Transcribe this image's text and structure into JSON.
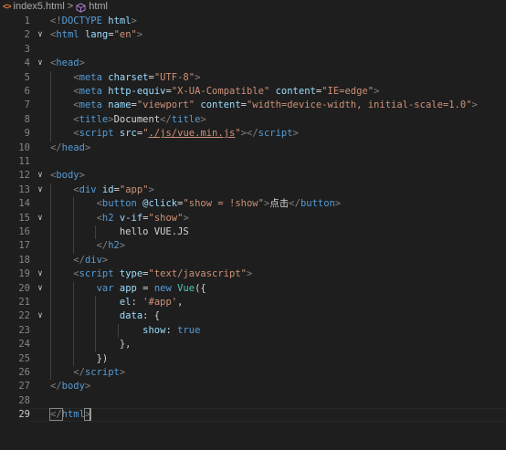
{
  "breadcrumb": {
    "file_icon": "<>",
    "file": "index5.html",
    "separator": ">",
    "node_icon": "cube-icon",
    "node": "html"
  },
  "editor": {
    "active_line": 29,
    "lines": [
      {
        "n": "1",
        "fold": "",
        "tokens": [
          [
            "br",
            "<!"
          ],
          [
            "tag",
            "DOCTYPE"
          ],
          [
            "at",
            " html"
          ],
          [
            "br",
            ">"
          ]
        ]
      },
      {
        "n": "2",
        "fold": "∨",
        "tokens": [
          [
            "br",
            "<"
          ],
          [
            "tag",
            "html"
          ],
          [
            "at",
            " lang"
          ],
          [
            "pl",
            "="
          ],
          [
            "str",
            "\"en\""
          ],
          [
            "br",
            ">"
          ]
        ]
      },
      {
        "n": "3",
        "fold": "",
        "tokens": []
      },
      {
        "n": "4",
        "fold": "∨",
        "tokens": [
          [
            "br",
            "<"
          ],
          [
            "tag",
            "head"
          ],
          [
            "br",
            ">"
          ]
        ]
      },
      {
        "n": "5",
        "fold": "",
        "tokens": [
          [
            "pl",
            "    "
          ],
          [
            "br",
            "<"
          ],
          [
            "tag",
            "meta"
          ],
          [
            "at",
            " charset"
          ],
          [
            "pl",
            "="
          ],
          [
            "str",
            "\"UTF-8\""
          ],
          [
            "br",
            ">"
          ]
        ]
      },
      {
        "n": "6",
        "fold": "",
        "tokens": [
          [
            "pl",
            "    "
          ],
          [
            "br",
            "<"
          ],
          [
            "tag",
            "meta"
          ],
          [
            "at",
            " http-equiv"
          ],
          [
            "pl",
            "="
          ],
          [
            "str",
            "\"X-UA-Compatible\""
          ],
          [
            "at",
            " content"
          ],
          [
            "pl",
            "="
          ],
          [
            "str",
            "\"IE=edge\""
          ],
          [
            "br",
            ">"
          ]
        ]
      },
      {
        "n": "7",
        "fold": "",
        "tokens": [
          [
            "pl",
            "    "
          ],
          [
            "br",
            "<"
          ],
          [
            "tag",
            "meta"
          ],
          [
            "at",
            " name"
          ],
          [
            "pl",
            "="
          ],
          [
            "str",
            "\"viewport\""
          ],
          [
            "at",
            " content"
          ],
          [
            "pl",
            "="
          ],
          [
            "str",
            "\"width=device-width, initial-scale=1.0\""
          ],
          [
            "br",
            ">"
          ]
        ]
      },
      {
        "n": "8",
        "fold": "",
        "tokens": [
          [
            "pl",
            "    "
          ],
          [
            "br",
            "<"
          ],
          [
            "tag",
            "title"
          ],
          [
            "br",
            ">"
          ],
          [
            "txt",
            "Document"
          ],
          [
            "br",
            "</"
          ],
          [
            "tag",
            "title"
          ],
          [
            "br",
            ">"
          ]
        ]
      },
      {
        "n": "9",
        "fold": "",
        "tokens": [
          [
            "pl",
            "    "
          ],
          [
            "br",
            "<"
          ],
          [
            "tag",
            "script"
          ],
          [
            "at",
            " src"
          ],
          [
            "pl",
            "="
          ],
          [
            "str",
            "\""
          ],
          [
            "link",
            "./js/vue.min.js"
          ],
          [
            "str",
            "\""
          ],
          [
            "br",
            "></"
          ],
          [
            "tag",
            "script"
          ],
          [
            "br",
            ">"
          ]
        ]
      },
      {
        "n": "10",
        "fold": "",
        "tokens": [
          [
            "br",
            "</"
          ],
          [
            "tag",
            "head"
          ],
          [
            "br",
            ">"
          ]
        ]
      },
      {
        "n": "11",
        "fold": "",
        "tokens": []
      },
      {
        "n": "12",
        "fold": "∨",
        "tokens": [
          [
            "br",
            "<"
          ],
          [
            "tag",
            "body"
          ],
          [
            "br",
            ">"
          ]
        ]
      },
      {
        "n": "13",
        "fold": "∨",
        "tokens": [
          [
            "pl",
            "    "
          ],
          [
            "br",
            "<"
          ],
          [
            "tag",
            "div"
          ],
          [
            "at",
            " id"
          ],
          [
            "pl",
            "="
          ],
          [
            "str",
            "\"app\""
          ],
          [
            "br",
            ">"
          ]
        ]
      },
      {
        "n": "14",
        "fold": "",
        "tokens": [
          [
            "pl",
            "        "
          ],
          [
            "br",
            "<"
          ],
          [
            "tag",
            "button"
          ],
          [
            "at",
            " @click"
          ],
          [
            "pl",
            "="
          ],
          [
            "str",
            "\"show = !show\""
          ],
          [
            "br",
            ">"
          ],
          [
            "txt",
            "点击"
          ],
          [
            "br",
            "</"
          ],
          [
            "tag",
            "button"
          ],
          [
            "br",
            ">"
          ]
        ]
      },
      {
        "n": "15",
        "fold": "∨",
        "tokens": [
          [
            "pl",
            "        "
          ],
          [
            "br",
            "<"
          ],
          [
            "tag",
            "h2"
          ],
          [
            "at",
            " v-if"
          ],
          [
            "pl",
            "="
          ],
          [
            "str",
            "\"show\""
          ],
          [
            "br",
            ">"
          ]
        ]
      },
      {
        "n": "16",
        "fold": "",
        "tokens": [
          [
            "pl",
            "            "
          ],
          [
            "txt",
            "hello VUE.JS"
          ]
        ]
      },
      {
        "n": "17",
        "fold": "",
        "tokens": [
          [
            "pl",
            "        "
          ],
          [
            "br",
            "</"
          ],
          [
            "tag",
            "h2"
          ],
          [
            "br",
            ">"
          ]
        ]
      },
      {
        "n": "18",
        "fold": "",
        "tokens": [
          [
            "pl",
            "    "
          ],
          [
            "br",
            "</"
          ],
          [
            "tag",
            "div"
          ],
          [
            "br",
            ">"
          ]
        ]
      },
      {
        "n": "19",
        "fold": "∨",
        "tokens": [
          [
            "pl",
            "    "
          ],
          [
            "br",
            "<"
          ],
          [
            "tag",
            "script"
          ],
          [
            "at",
            " type"
          ],
          [
            "pl",
            "="
          ],
          [
            "str",
            "\"text/javascript\""
          ],
          [
            "br",
            ">"
          ]
        ]
      },
      {
        "n": "20",
        "fold": "∨",
        "tokens": [
          [
            "pl",
            "        "
          ],
          [
            "kw",
            "var"
          ],
          [
            "var",
            " app"
          ],
          [
            "pl",
            " = "
          ],
          [
            "kw",
            "new"
          ],
          [
            "fn",
            " Vue"
          ],
          [
            "pl",
            "({"
          ]
        ]
      },
      {
        "n": "21",
        "fold": "",
        "tokens": [
          [
            "pl",
            "            "
          ],
          [
            "var",
            "el"
          ],
          [
            "pl",
            ": "
          ],
          [
            "str",
            "'#app'"
          ],
          [
            "pl",
            ","
          ]
        ]
      },
      {
        "n": "22",
        "fold": "∨",
        "tokens": [
          [
            "pl",
            "            "
          ],
          [
            "var",
            "data"
          ],
          [
            "pl",
            ": {"
          ]
        ]
      },
      {
        "n": "23",
        "fold": "",
        "tokens": [
          [
            "pl",
            "                "
          ],
          [
            "var",
            "show"
          ],
          [
            "pl",
            ": "
          ],
          [
            "kw",
            "true"
          ]
        ]
      },
      {
        "n": "24",
        "fold": "",
        "tokens": [
          [
            "pl",
            "            "
          ],
          [
            "pl",
            "},"
          ]
        ]
      },
      {
        "n": "25",
        "fold": "",
        "tokens": [
          [
            "pl",
            "        "
          ],
          [
            "pl",
            "})"
          ]
        ]
      },
      {
        "n": "26",
        "fold": "",
        "tokens": [
          [
            "pl",
            "    "
          ],
          [
            "br",
            "</"
          ],
          [
            "tag",
            "script"
          ],
          [
            "br",
            ">"
          ]
        ]
      },
      {
        "n": "27",
        "fold": "",
        "tokens": [
          [
            "br",
            "</"
          ],
          [
            "tag",
            "body"
          ],
          [
            "br",
            ">"
          ]
        ]
      },
      {
        "n": "28",
        "fold": "",
        "tokens": []
      },
      {
        "n": "29",
        "fold": "",
        "tokens": [
          [
            "br",
            "</"
          ],
          [
            "tag",
            "html"
          ],
          [
            "br",
            ">"
          ]
        ]
      }
    ]
  }
}
